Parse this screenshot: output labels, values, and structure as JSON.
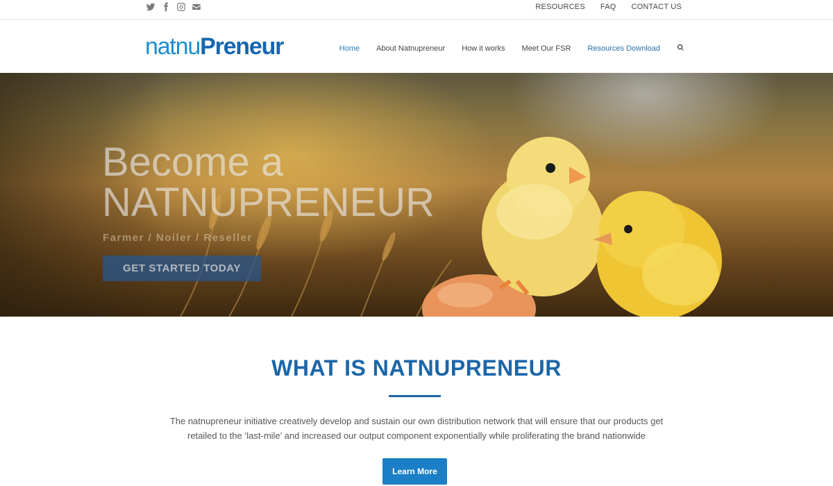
{
  "topbar": {
    "social": [
      "twitter-icon",
      "facebook-icon",
      "instagram-icon",
      "envelope-icon"
    ],
    "links": [
      "RESOURCES",
      "FAQ",
      "CONTACT US"
    ]
  },
  "header": {
    "logo_part1": "natnu",
    "logo_part2": "Preneur",
    "nav": [
      "Home",
      "About Natnupreneur",
      "How it works",
      "Meet Our FSR",
      "Resources Download"
    ]
  },
  "hero": {
    "title_line1": "Become a",
    "title_line2": "NATNUPRENEUR",
    "subtitle": "Farmer / Noiler / Reseller",
    "cta_label": "GET STARTED TODAY"
  },
  "section": {
    "title": "WHAT IS NATNUPRENEUR",
    "description_line1": "The natnupreneur initiative creatively develop and sustain our own distribution network that will ensure that our products get",
    "description_line2": "retailed to the ‘last-mile’ and increased our output component exponentially while proliferating the brand nationwide",
    "button_label": "Learn More"
  },
  "colors": {
    "brand_light": "#1c8fd0",
    "brand_dark": "#1566b0",
    "accent_button": "#1a7fc6"
  }
}
